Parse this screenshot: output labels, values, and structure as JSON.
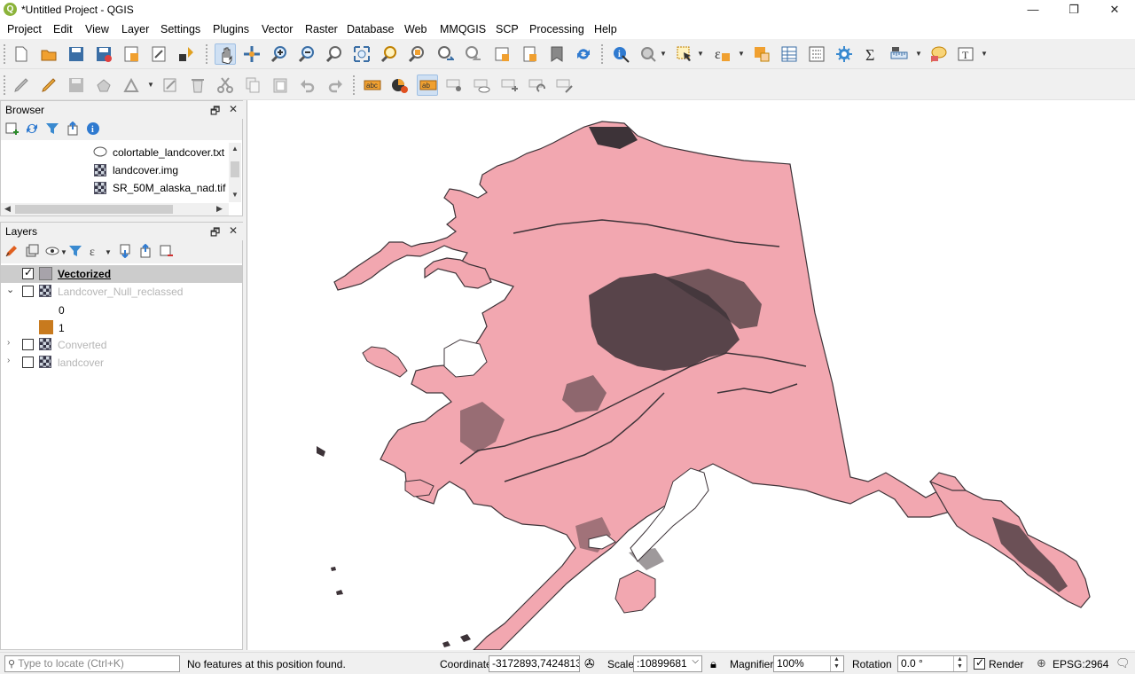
{
  "window": {
    "title": "*Untitled Project - QGIS",
    "app_icon_letter": "Q",
    "minimize_glyph": "—",
    "restore_glyph": "❐",
    "close_glyph": "✕"
  },
  "menubar": {
    "items": [
      "Project",
      "Edit",
      "View",
      "Layer",
      "Settings",
      "Plugins",
      "Vector",
      "Raster",
      "Database",
      "Web",
      "MMQGIS",
      "SCP",
      "Processing",
      "Help"
    ]
  },
  "toolbar": {
    "text_annotation_glyph": "T",
    "label_text": "abc",
    "label_text2": "ab"
  },
  "browser": {
    "title": "Browser",
    "float_glyph": "🗗",
    "close_glyph": "✕",
    "items": [
      {
        "label": "colortable_landcover.txt",
        "icon": "text-file-icon"
      },
      {
        "label": "landcover.img",
        "icon": "raster-icon"
      },
      {
        "label": "SR_50M_alaska_nad.tif",
        "icon": "raster-icon"
      }
    ]
  },
  "layers": {
    "title": "Layers",
    "float_glyph": "🗗",
    "close_glyph": "✕",
    "items": [
      {
        "label": "Vectorized",
        "checked": true,
        "selected": true,
        "type": "vector"
      },
      {
        "label": "Landcover_Null_reclassed",
        "checked": false,
        "expanded": true,
        "type": "raster",
        "legend": [
          {
            "label": "0",
            "color": "#ffffff"
          },
          {
            "label": "1",
            "color": "#c87a1e"
          }
        ]
      },
      {
        "label": "Converted",
        "checked": false,
        "expanded": false,
        "type": "raster"
      },
      {
        "label": "landcover",
        "checked": false,
        "expanded": false,
        "type": "raster"
      }
    ]
  },
  "map": {
    "fill_color": "#f2a7b0",
    "feature_color": "#3d3338",
    "background": "#ffffff"
  },
  "statusbar": {
    "locate_placeholder": "Type to locate (Ctrl+K)",
    "message": "No features at this position found.",
    "coordinate_label": "Coordinate",
    "coordinate_value": "-3172893,7424813",
    "scale_label": "Scale",
    "scale_value": ":10899681",
    "magnifier_label": "Magnifier",
    "magnifier_value": "100%",
    "rotation_label": "Rotation",
    "rotation_value": "0.0 °",
    "render_label": "Render",
    "render_checked": true,
    "crs": "EPSG:2964"
  }
}
